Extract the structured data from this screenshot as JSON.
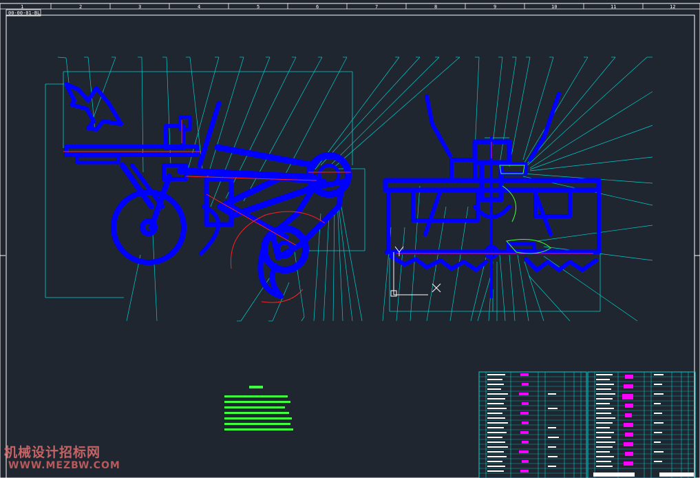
{
  "drawing": {
    "code": "00-00-01-BL"
  },
  "ruler": {
    "numbers": [
      "1",
      "2",
      "3",
      "4",
      "5",
      "6",
      "7",
      "8",
      "9",
      "10",
      "11",
      "12"
    ]
  },
  "watermark": {
    "site_name": "机械设计招标网",
    "site_url": "WWW.MEZBW.COM"
  },
  "colors": {
    "background": "#202630",
    "frame": "#ffffff",
    "part_outline": "#0000ff",
    "dimension_line": "#00d0d0",
    "center_line": "#ff2020",
    "notes_text": "#40ff40",
    "bom_highlight": "#ff00ff"
  }
}
